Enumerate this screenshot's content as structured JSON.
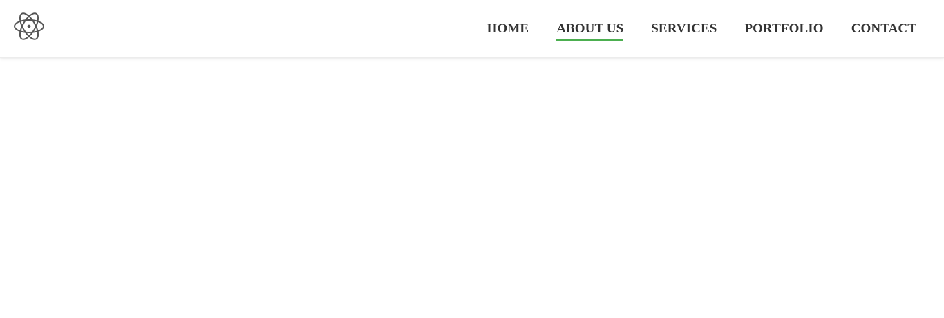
{
  "header": {
    "logo_icon": "atom-icon",
    "nav": [
      {
        "label": "HOME",
        "active": false
      },
      {
        "label": "ABOUT US",
        "active": true
      },
      {
        "label": "SERVICES",
        "active": false
      },
      {
        "label": "PORTFOLIO",
        "active": false
      },
      {
        "label": "CONTACT",
        "active": false
      }
    ]
  },
  "colors": {
    "accent": "#4caf50",
    "nav_text": "#333333",
    "logo": "#555555"
  }
}
